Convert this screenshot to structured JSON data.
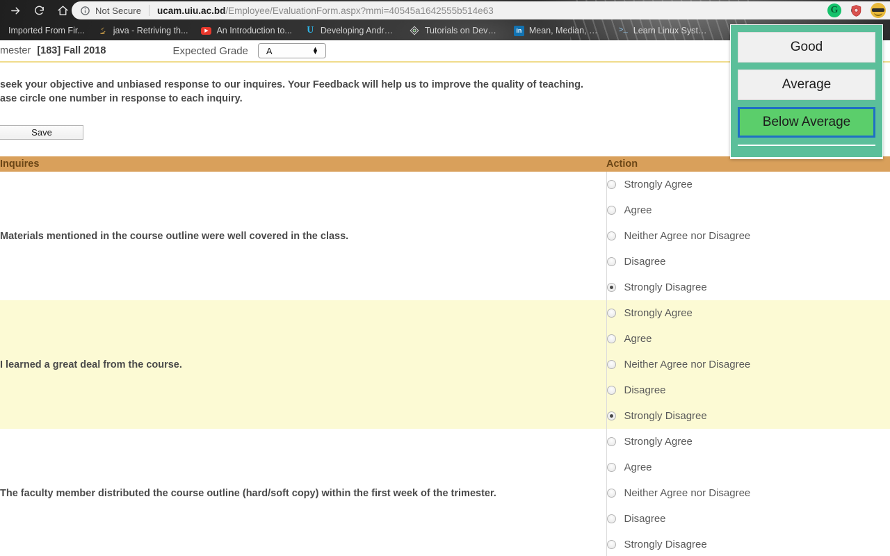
{
  "browser": {
    "nav_icons": [
      {
        "name": "forward-button",
        "glyph": "→"
      },
      {
        "name": "reload-button",
        "glyph": "⟳"
      },
      {
        "name": "home-button",
        "glyph": "⌂"
      }
    ],
    "omnibox": {
      "security_label": "Not Secure",
      "url_host": "ucam.uiu.ac.bd",
      "url_path": "/Employee/EvaluationForm.aspx?mmi=40545a1642555b514e63",
      "info_icon": "info-icon",
      "search_icon": "search-icon",
      "bookmark_icon": "star-icon"
    },
    "extensions": [
      {
        "name": "grammarly-extension-icon",
        "glyph": "G",
        "color": "#15c26b"
      },
      {
        "name": "adblock-shield-extension-icon",
        "glyph": "⛨",
        "color": "#d9534f"
      },
      {
        "name": "profile-avatar",
        "glyph": "",
        "color": "#e8b93a"
      }
    ],
    "bookmarks": [
      {
        "label": "Imported From Fir...",
        "icon": "folder-icon"
      },
      {
        "label": "java - Retriving th...",
        "icon": "java-icon"
      },
      {
        "label": "An Introduction to...",
        "icon": "youtube-icon"
      },
      {
        "label": "Developing Androi...",
        "icon": "udacity-icon"
      },
      {
        "label": "Tutorials on DevO...",
        "icon": "devops-icon"
      },
      {
        "label": "Mean, Median, Mo...",
        "icon": "linkedin-icon"
      },
      {
        "label": "Learn Linux Syste...",
        "icon": "terminal-icon"
      }
    ]
  },
  "form": {
    "semester_label": "mester",
    "semester_value": "[183] Fall 2018",
    "expected_grade_label": "Expected Grade",
    "expected_grade_value": "A",
    "instructions": [
      "seek your objective and unbiased response to our inquires. Your Feedback will help us to improve the quality of teaching.",
      "ase circle one number in response to each inquiry."
    ],
    "save_label": "Save",
    "columns": {
      "inquiries": "Inquires",
      "action": "Action"
    },
    "options": [
      "Strongly Agree",
      "Agree",
      "Neither Agree nor Disagree",
      "Disagree",
      "Strongly Disagree"
    ],
    "rows": [
      {
        "question": "Materials mentioned in the course outline were well covered in the class.",
        "selected": "Strongly Disagree",
        "highlighted": false
      },
      {
        "question": "I learned a great deal from the course.",
        "selected": "Strongly Disagree",
        "highlighted": true
      },
      {
        "question": "The faculty member distributed the course outline (hard/soft copy) within the first week of the trimester.",
        "selected": null,
        "highlighted": false
      }
    ]
  },
  "rating_popup": {
    "options": [
      {
        "label": "Good",
        "selected": false
      },
      {
        "label": "Average",
        "selected": false
      },
      {
        "label": "Below Average",
        "selected": true
      }
    ],
    "accent_color": "#5bbf9a",
    "selected_fill": "#5bce6b",
    "selected_border": "#1f6fc4"
  }
}
